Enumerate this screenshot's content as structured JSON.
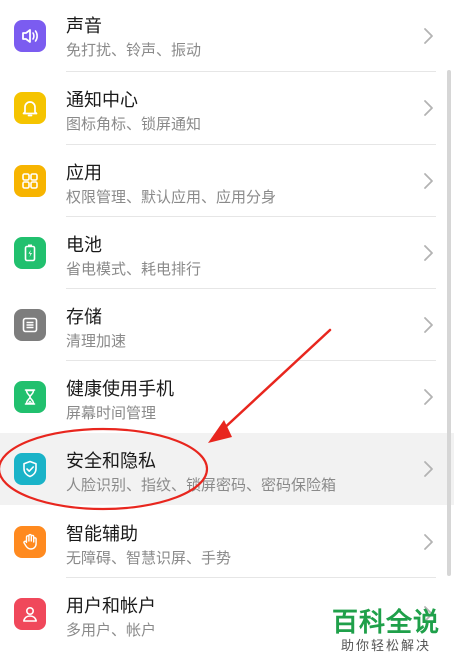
{
  "settings": {
    "items": [
      {
        "key": "sound",
        "title": "声音",
        "subtitle": "免打扰、铃声、振动",
        "icon": "sound-icon",
        "color": "#7b5cf0"
      },
      {
        "key": "notifications",
        "title": "通知中心",
        "subtitle": "图标角标、锁屏通知",
        "icon": "bell-icon",
        "color": "#f5c400"
      },
      {
        "key": "apps",
        "title": "应用",
        "subtitle": "权限管理、默认应用、应用分身",
        "icon": "apps-grid-icon",
        "color": "#f7b400"
      },
      {
        "key": "battery",
        "title": "电池",
        "subtitle": "省电模式、耗电排行",
        "icon": "battery-icon",
        "color": "#21c06e"
      },
      {
        "key": "storage",
        "title": "存储",
        "subtitle": "清理加速",
        "icon": "storage-icon",
        "color": "#7d7d7d"
      },
      {
        "key": "digital-balance",
        "title": "健康使用手机",
        "subtitle": "屏幕时间管理",
        "icon": "hourglass-icon",
        "color": "#21c06e"
      },
      {
        "key": "security",
        "title": "安全和隐私",
        "subtitle": "人脸识别、指纹、锁屏密码、密码保险箱",
        "icon": "shield-icon",
        "color": "#1ab3c8"
      },
      {
        "key": "accessibility",
        "title": "智能辅助",
        "subtitle": "无障碍、智慧识屏、手势",
        "icon": "hand-icon",
        "color": "#ff8a1f"
      },
      {
        "key": "accounts",
        "title": "用户和帐户",
        "subtitle": "多用户、帐户",
        "icon": "user-icon",
        "color": "#f0485b"
      }
    ]
  },
  "watermark": {
    "main": "百科全说",
    "sub": "助你轻松解决"
  },
  "annotation_color": "#e8261e"
}
